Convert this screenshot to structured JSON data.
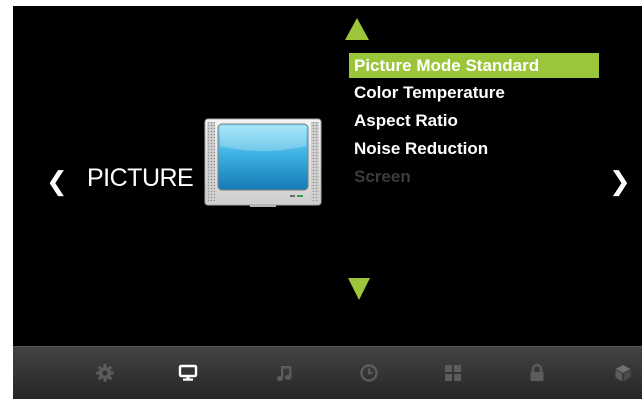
{
  "category": {
    "label": "PICTURE"
  },
  "nav": {
    "prev_glyph": "❮",
    "next_glyph": "❯"
  },
  "menu": {
    "items": [
      {
        "label": "Picture Mode Standard",
        "state": "selected"
      },
      {
        "label": "Color  Temperature",
        "state": "normal"
      },
      {
        "label": "Aspect  Ratio",
        "state": "normal"
      },
      {
        "label": "Noise  Reduction",
        "state": "normal"
      },
      {
        "label": "Screen",
        "state": "disabled"
      }
    ]
  },
  "bottom_bar": {
    "icons": [
      "gear-icon",
      "monitor-icon",
      "music-note-icon",
      "clock-icon",
      "grid-icon",
      "lock-icon",
      "cube-icon"
    ],
    "active": "monitor-icon"
  },
  "colors": {
    "accent": "#9bc63b",
    "background": "#000000",
    "text": "#ffffff",
    "disabled_text": "#3c3c3c",
    "icon_inactive": "#5c5c5c",
    "icon_active": "#ffffff"
  }
}
